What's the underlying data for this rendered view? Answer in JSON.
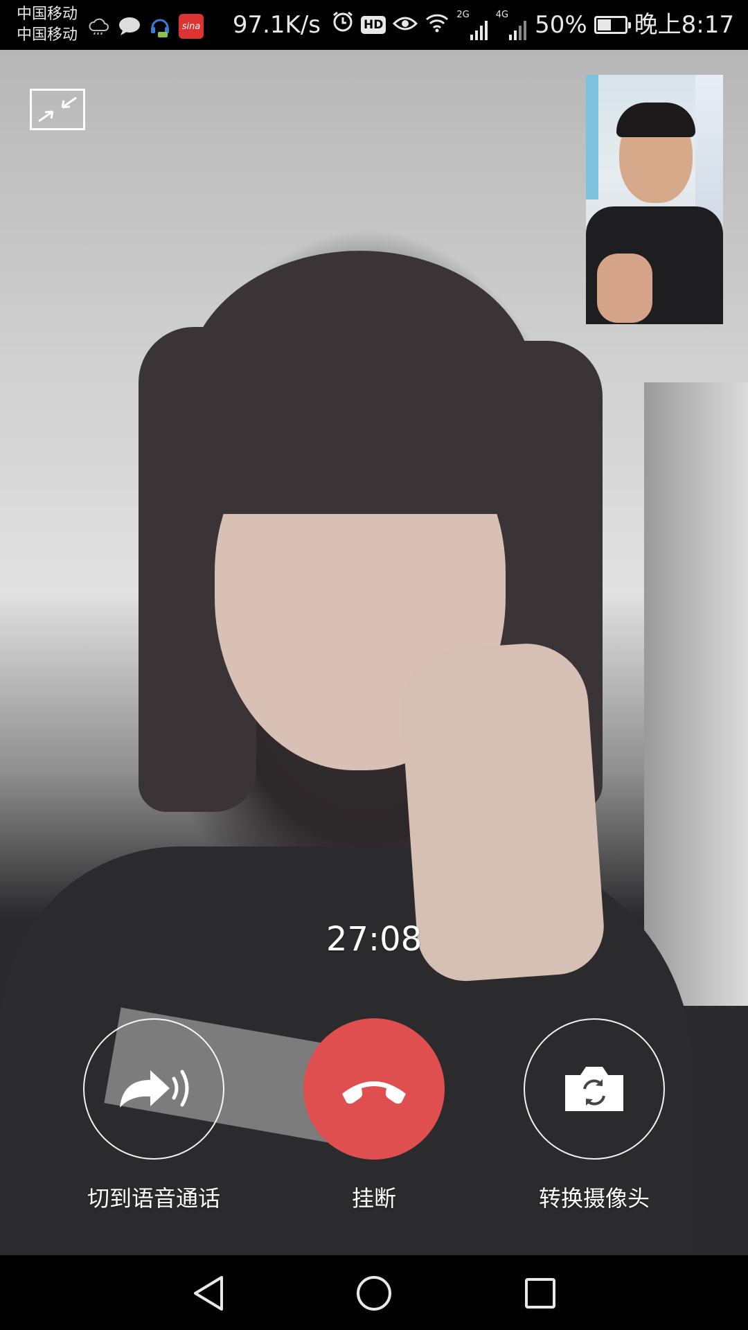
{
  "status_bar": {
    "carrier_1": "中国移动",
    "carrier_2": "中国移动",
    "net_speed": "97.1K/s",
    "hd": "HD",
    "signal_1_label": "2G",
    "signal_2_label": "4G",
    "battery_percent": "50%",
    "battery_level": 0.5,
    "time": "晚上8:17",
    "icons": [
      "cloud-icon",
      "chat-bubble-icon",
      "headset-app-icon",
      "sina-weibo-icon",
      "alarm-icon",
      "hd-icon",
      "eye-icon",
      "wifi-icon",
      "signal-2g-icon",
      "signal-4g-icon",
      "battery-icon"
    ]
  },
  "call": {
    "duration": "27:08",
    "minimize_icon": "minimize-icon",
    "controls": {
      "switch_to_voice": {
        "label": "切到语音通话",
        "icon": "switch-to-voice-icon"
      },
      "hang_up": {
        "label": "挂断",
        "icon": "phone-hangup-icon",
        "color": "#e04f4f"
      },
      "switch_camera": {
        "label": "转换摄像头",
        "icon": "camera-switch-icon"
      }
    }
  },
  "nav_bar": {
    "icons": [
      "back-triangle-icon",
      "home-circle-icon",
      "recent-apps-square-icon"
    ]
  }
}
